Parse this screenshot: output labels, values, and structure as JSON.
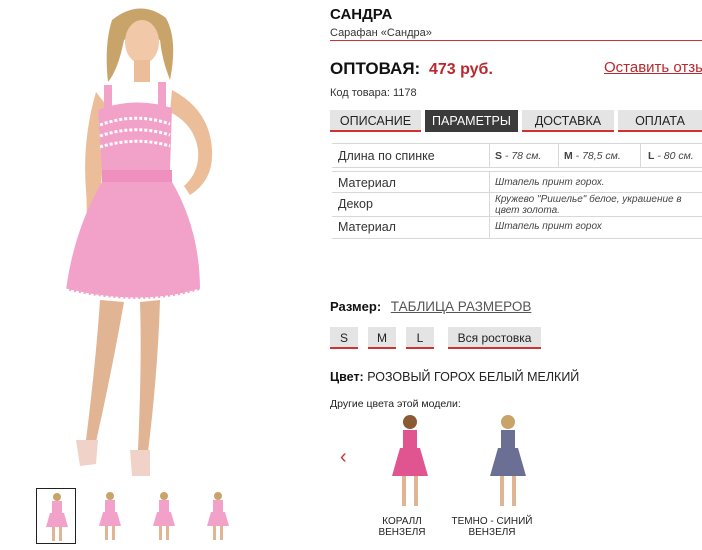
{
  "product": {
    "title": "САНДРА",
    "subtitle": "Сарафан «Сандра»",
    "price_label": "ОПТОВАЯ:",
    "price_value": "473 руб.",
    "review_link": "Оставить отзы",
    "sku": "Код товара: 1178"
  },
  "tabs": [
    {
      "label": "ОПИСАНИЕ",
      "active": false
    },
    {
      "label": "ПАРАМЕТРЫ",
      "active": true
    },
    {
      "label": "ДОСТАВКА",
      "active": false
    },
    {
      "label": "ОПЛАТА",
      "active": false
    }
  ],
  "params": {
    "length": {
      "name": "Длина по спинке",
      "s_label": "S",
      "s_value": " - 78 см.",
      "m_label": "M",
      "m_value": " - 78,5 см.",
      "l_label": "L",
      "l_value": " - 80 см."
    },
    "rows": [
      {
        "name": "Материал",
        "value": "Штапель принт горох."
      },
      {
        "name": "Декор",
        "value": "Кружево \"Ришелье\" белое, украшение в цвет золота."
      },
      {
        "name": "Материал",
        "value": "Штапель принт горох"
      }
    ]
  },
  "size": {
    "label": "Размер:",
    "chart_link": "ТАБЛИЦА РАЗМЕРОВ",
    "options": [
      "S",
      "M",
      "L",
      "Вся ростовка"
    ]
  },
  "color": {
    "label": "Цвет:",
    "value": "РОЗОВЫЙ ГОРОХ БЕЛЫЙ МЕЛКИЙ",
    "other_label": "Другие цвета этой модели:",
    "variants": [
      {
        "name_line1": "КОРАЛЛ",
        "name_line2": "ВЕНЗЕЛЯ",
        "color": "#e0558f"
      },
      {
        "name_line1": "ТЕМНО - СИНИЙ",
        "name_line2": "ВЕНЗЕЛЯ",
        "color": "#6a6f93"
      }
    ]
  },
  "colors": {
    "accent": "#b8282e",
    "dress": "#f2a2c8",
    "tab_active": "#3b3b3b"
  }
}
